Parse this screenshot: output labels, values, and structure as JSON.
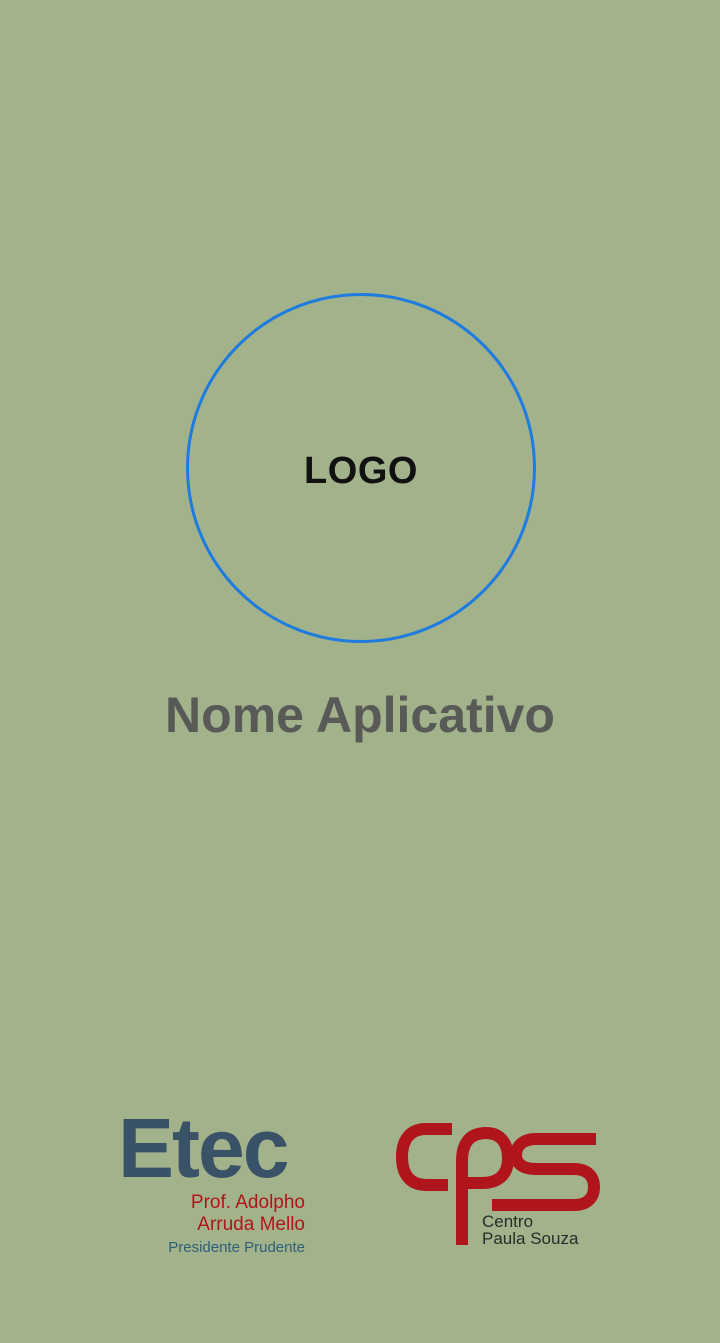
{
  "splash": {
    "logo_placeholder": "LOGO",
    "app_name": "Nome Aplicativo"
  },
  "footer": {
    "etec_logo": {
      "main": "Etec",
      "line1": "Prof. Adolpho",
      "line2": "Arruda Mello",
      "line3": "Presidente Prudente"
    },
    "cps_logo": {
      "mark": "cps",
      "line1": "Centro",
      "line2": "Paula Souza"
    }
  },
  "colors": {
    "background": "#a2b28a",
    "circle_border": "#1e7be0",
    "app_name": "#575a57",
    "etec_blue": "#3a5268",
    "etec_red": "#b0151b",
    "cps_red": "#b0151b"
  }
}
